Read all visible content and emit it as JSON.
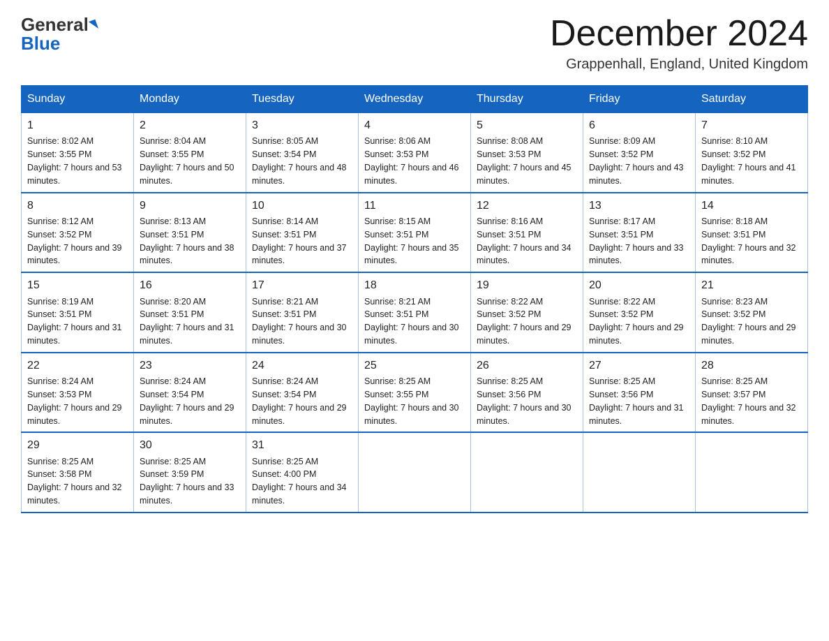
{
  "logo": {
    "general": "General",
    "blue": "Blue"
  },
  "title": "December 2024",
  "location": "Grappenhall, England, United Kingdom",
  "days_of_week": [
    "Sunday",
    "Monday",
    "Tuesday",
    "Wednesday",
    "Thursday",
    "Friday",
    "Saturday"
  ],
  "weeks": [
    [
      {
        "day": "1",
        "sunrise": "8:02 AM",
        "sunset": "3:55 PM",
        "daylight": "7 hours and 53 minutes."
      },
      {
        "day": "2",
        "sunrise": "8:04 AM",
        "sunset": "3:55 PM",
        "daylight": "7 hours and 50 minutes."
      },
      {
        "day": "3",
        "sunrise": "8:05 AM",
        "sunset": "3:54 PM",
        "daylight": "7 hours and 48 minutes."
      },
      {
        "day": "4",
        "sunrise": "8:06 AM",
        "sunset": "3:53 PM",
        "daylight": "7 hours and 46 minutes."
      },
      {
        "day": "5",
        "sunrise": "8:08 AM",
        "sunset": "3:53 PM",
        "daylight": "7 hours and 45 minutes."
      },
      {
        "day": "6",
        "sunrise": "8:09 AM",
        "sunset": "3:52 PM",
        "daylight": "7 hours and 43 minutes."
      },
      {
        "day": "7",
        "sunrise": "8:10 AM",
        "sunset": "3:52 PM",
        "daylight": "7 hours and 41 minutes."
      }
    ],
    [
      {
        "day": "8",
        "sunrise": "8:12 AM",
        "sunset": "3:52 PM",
        "daylight": "7 hours and 39 minutes."
      },
      {
        "day": "9",
        "sunrise": "8:13 AM",
        "sunset": "3:51 PM",
        "daylight": "7 hours and 38 minutes."
      },
      {
        "day": "10",
        "sunrise": "8:14 AM",
        "sunset": "3:51 PM",
        "daylight": "7 hours and 37 minutes."
      },
      {
        "day": "11",
        "sunrise": "8:15 AM",
        "sunset": "3:51 PM",
        "daylight": "7 hours and 35 minutes."
      },
      {
        "day": "12",
        "sunrise": "8:16 AM",
        "sunset": "3:51 PM",
        "daylight": "7 hours and 34 minutes."
      },
      {
        "day": "13",
        "sunrise": "8:17 AM",
        "sunset": "3:51 PM",
        "daylight": "7 hours and 33 minutes."
      },
      {
        "day": "14",
        "sunrise": "8:18 AM",
        "sunset": "3:51 PM",
        "daylight": "7 hours and 32 minutes."
      }
    ],
    [
      {
        "day": "15",
        "sunrise": "8:19 AM",
        "sunset": "3:51 PM",
        "daylight": "7 hours and 31 minutes."
      },
      {
        "day": "16",
        "sunrise": "8:20 AM",
        "sunset": "3:51 PM",
        "daylight": "7 hours and 31 minutes."
      },
      {
        "day": "17",
        "sunrise": "8:21 AM",
        "sunset": "3:51 PM",
        "daylight": "7 hours and 30 minutes."
      },
      {
        "day": "18",
        "sunrise": "8:21 AM",
        "sunset": "3:51 PM",
        "daylight": "7 hours and 30 minutes."
      },
      {
        "day": "19",
        "sunrise": "8:22 AM",
        "sunset": "3:52 PM",
        "daylight": "7 hours and 29 minutes."
      },
      {
        "day": "20",
        "sunrise": "8:22 AM",
        "sunset": "3:52 PM",
        "daylight": "7 hours and 29 minutes."
      },
      {
        "day": "21",
        "sunrise": "8:23 AM",
        "sunset": "3:52 PM",
        "daylight": "7 hours and 29 minutes."
      }
    ],
    [
      {
        "day": "22",
        "sunrise": "8:24 AM",
        "sunset": "3:53 PM",
        "daylight": "7 hours and 29 minutes."
      },
      {
        "day": "23",
        "sunrise": "8:24 AM",
        "sunset": "3:54 PM",
        "daylight": "7 hours and 29 minutes."
      },
      {
        "day": "24",
        "sunrise": "8:24 AM",
        "sunset": "3:54 PM",
        "daylight": "7 hours and 29 minutes."
      },
      {
        "day": "25",
        "sunrise": "8:25 AM",
        "sunset": "3:55 PM",
        "daylight": "7 hours and 30 minutes."
      },
      {
        "day": "26",
        "sunrise": "8:25 AM",
        "sunset": "3:56 PM",
        "daylight": "7 hours and 30 minutes."
      },
      {
        "day": "27",
        "sunrise": "8:25 AM",
        "sunset": "3:56 PM",
        "daylight": "7 hours and 31 minutes."
      },
      {
        "day": "28",
        "sunrise": "8:25 AM",
        "sunset": "3:57 PM",
        "daylight": "7 hours and 32 minutes."
      }
    ],
    [
      {
        "day": "29",
        "sunrise": "8:25 AM",
        "sunset": "3:58 PM",
        "daylight": "7 hours and 32 minutes."
      },
      {
        "day": "30",
        "sunrise": "8:25 AM",
        "sunset": "3:59 PM",
        "daylight": "7 hours and 33 minutes."
      },
      {
        "day": "31",
        "sunrise": "8:25 AM",
        "sunset": "4:00 PM",
        "daylight": "7 hours and 34 minutes."
      },
      null,
      null,
      null,
      null
    ]
  ]
}
